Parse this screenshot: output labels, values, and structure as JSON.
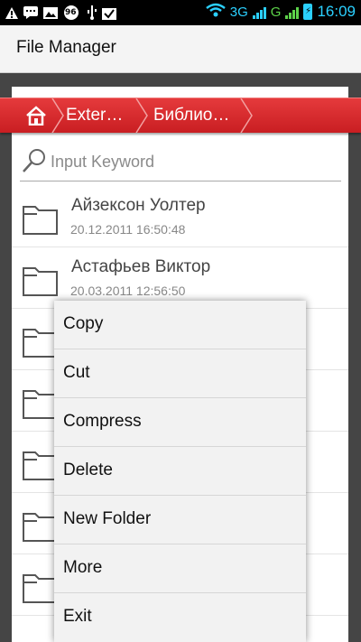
{
  "status_bar": {
    "battery_level": "96",
    "network_3g": "3G",
    "network_g": "G",
    "time": "16:09",
    "accent_color": "#2bd0ff"
  },
  "app": {
    "title": "File Manager"
  },
  "breadcrumb": {
    "home_icon": "home-icon",
    "items": [
      "Exter…",
      "Библио…"
    ],
    "color": "#d42a2d"
  },
  "search": {
    "placeholder": "Input Keyword"
  },
  "files": [
    {
      "name": "Айзексон Уолтер",
      "date": "20.12.2011 16:50:48"
    },
    {
      "name": "Астафьев Виктор",
      "date": "20.03.2011 12:56:50"
    },
    {
      "name": "",
      "date": ""
    },
    {
      "name": "",
      "date": ""
    },
    {
      "name": "",
      "date": ""
    },
    {
      "name": "",
      "date": ""
    },
    {
      "name": "",
      "date": ""
    }
  ],
  "context_menu": {
    "items": [
      "Copy",
      "Cut",
      "Compress",
      "Delete",
      "New Folder",
      "More",
      "Exit"
    ]
  }
}
